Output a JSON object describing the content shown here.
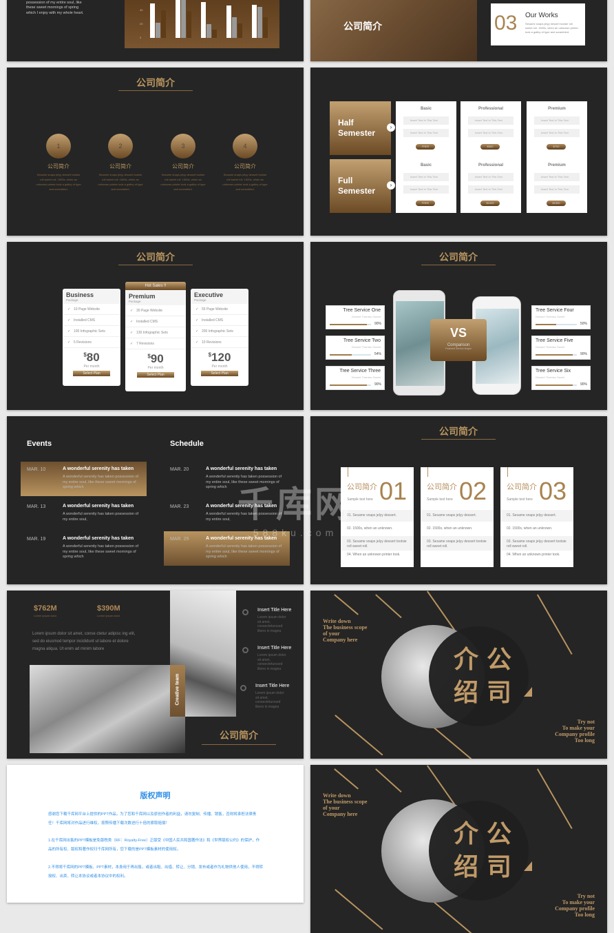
{
  "colors": {
    "slide_bg": "#252525",
    "gold": "#b58f5e",
    "copyright_blue": "#2f8fe6"
  },
  "row0": {
    "left_text": "A wonderful serenity has taken possession of my entire soul, like these sweet mornings of spring which I enjoy with my whole heart.",
    "chart_bars": [
      [
        50,
        22,
        40
      ],
      [
        55,
        60,
        39
      ],
      [
        52,
        20,
        12
      ],
      [
        47,
        30,
        21
      ],
      [
        48,
        45,
        30
      ]
    ],
    "chart_yticks": [
      "0",
      "20",
      "40"
    ],
    "right_title": "公司简介",
    "card_num": "03",
    "card_title": "Our Works",
    "card_text": "Sesame snaps jelyy dessert toolsie roll sweet roll. 1500s, when an unknown printer took a galley of type and scrambled."
  },
  "row1": {
    "title": "公司简介",
    "steps": [
      {
        "num": "1",
        "label": "公司简介",
        "text": "Sesame snaps jelyy dessert tootsie roll sweet roll. 1500s, when an unknown printer took a galley of type and scrambled."
      },
      {
        "num": "2",
        "label": "公司简介",
        "text": "Sesame snaps jelyy dessert tootsie roll sweet roll. 1500s, when an unknown printer took a galley of type and scrambled."
      },
      {
        "num": "3",
        "label": "公司简介",
        "text": "Sesame snaps jelyy dessert tootsie roll sweet roll. 1500s, when an unknown printer took a galley of type and scrambled."
      },
      {
        "num": "4",
        "label": "公司简介",
        "text": "Sesame snaps jelyy dessert tootsie roll sweet roll. 1500s, when an unknown printer took a galley of type and scrambled."
      }
    ],
    "semesters": [
      "Half Semester",
      "Full Semester"
    ],
    "plans": [
      "Basic",
      "Professional",
      "Premium"
    ],
    "feature": "Insert Text In This Text",
    "prices": [
      [
        "FREE",
        "$500",
        "$700"
      ],
      [
        "FREE",
        "$1000",
        "$1500"
      ]
    ]
  },
  "row2": {
    "title_left": "公司简介",
    "packages": [
      {
        "name": "Business",
        "sub": "Package",
        "features": [
          "10 Page Website",
          "Installed CMS",
          "100 Infographic Sets",
          "5 Revisions"
        ],
        "price": "80",
        "period": "Per month",
        "cta": "Select Plan"
      },
      {
        "name": "Premium",
        "sub": "Package",
        "badge": "Hot Sales !!",
        "features": [
          "30 Page Website",
          "Installed CMS",
          "130 Infographic Sets",
          "7 Revisions"
        ],
        "price": "90",
        "period": "Per month",
        "cta": "Select Plan"
      },
      {
        "name": "Executive",
        "sub": "Package",
        "features": [
          "55 Page Website",
          "Installed CMS",
          "200 Infographic Sets",
          "10 Revisions"
        ],
        "price": "120",
        "period": "Per month",
        "cta": "Select Plan"
      }
    ],
    "currency": "$",
    "title_right": "公司简介",
    "services": [
      {
        "name": "Tree Service One",
        "sub": "Dessert Tiramisu Sweet",
        "pct": 90,
        "label": "90%"
      },
      {
        "name": "Tree Service Two",
        "sub": "Dessert Tiramisu Sweet",
        "pct": 54,
        "label": "54%"
      },
      {
        "name": "Tree Service Three",
        "sub": "Dessert Tiramisu Sweet",
        "pct": 90,
        "label": "90%"
      },
      {
        "name": "Tree Service Four",
        "sub": "Dessert Tiramisu Sweet",
        "pct": 50,
        "label": "50%"
      },
      {
        "name": "Tree Service Five",
        "sub": "Dessert Tiramisu Sweet",
        "pct": 90,
        "label": "90%"
      },
      {
        "name": "Tree Service Six",
        "sub": "Dessert Tiramisu Sweet",
        "pct": 90,
        "label": "90%"
      }
    ],
    "vs": "VS",
    "vs_sub": "Comparison",
    "vs_slogan": "Featured Service slogan"
  },
  "row3": {
    "events_title": "Events",
    "schedule_title": "Schedule",
    "events": [
      {
        "date": "MAR. 10",
        "title": "A wonderful serenity has taken",
        "text": "A wonderful serenity has taken possession of my entire soul, like these sweet mornings of spring which",
        "hl": true
      },
      {
        "date": "MAR. 13",
        "title": "A wonderful serenity has taken",
        "text": "A wonderful serenity has taken possession of my entire soul,",
        "hl": false
      },
      {
        "date": "MAR. 19",
        "title": "A wonderful serenity has taken",
        "text": "A wonderful serenity has taken possession of my entire soul, like these sweet mornings of spring which",
        "hl": false
      }
    ],
    "schedule": [
      {
        "date": "MAR. 20",
        "title": "A wonderful serenity has taken",
        "text": "A wonderful serenity has taken possession of my entire soul, like these sweet mornings of spring which",
        "hl": false
      },
      {
        "date": "MAR. 23",
        "title": "A wonderful serenity has taken",
        "text": "A wonderful serenity has taken possession of my entire soul,",
        "hl": false
      },
      {
        "date": "MAR. 29",
        "title": "A wonderful serenity has taken",
        "text": "A wonderful serenity has taken possession of my entire soul, like these sweet mornings of spring which",
        "hl": true
      }
    ],
    "title_right": "公司简介",
    "cards": [
      {
        "cn": "公司简介",
        "num": "01",
        "sample": "Sample text here",
        "items": [
          "01. Sesame snaps jelyy dessert.",
          "02. 1500s, when an unknown.",
          "03. Sesame snaps jelyy dessert tootsie roll sweet roll.",
          "04. When an unknown printer took."
        ]
      },
      {
        "cn": "公司简介",
        "num": "02",
        "sample": "Sample text here",
        "items": [
          "01. Sesame snaps jelyy dessert.",
          "02. 1500s, when an unknown.",
          "03. Sesame snaps jelyy dessert tootsie roll sweet roll."
        ]
      },
      {
        "cn": "公司简介",
        "num": "03",
        "sample": "Sample text here",
        "items": [
          "01. Sesame snaps jelyy dessert.",
          "02. 1500s, when an unknown.",
          "03. Sesame snaps jelyy dessert tootsie roll sweet roll.",
          "04. When an unknown printer took."
        ]
      }
    ]
  },
  "row4": {
    "stat1": "$762M",
    "stat1_sub": "Lorem ipsum dolor",
    "stat2": "$390M",
    "stat2_sub": "Lorem ipsum dolor",
    "para": "Lorem ipsum dolor sit amet, conse ctetur adipisc ing elit, sed do eiusmod tempor incididunt ut labore et dolore magna aliqua. Ut enim ad minim labore",
    "strip": "Creative team",
    "items": [
      {
        "title": "Insert Title Here",
        "text": "Lorem ipsum dolor sit amet, consecteturssed libero in magna"
      },
      {
        "title": "Insert Title Here",
        "text": "Lorem ipsum dolor sit amet, consecteturssed libero in magna"
      },
      {
        "title": "Insert Title Here",
        "text": "Lorem ipsum dolor sit amet, consecteturssed libero in magna"
      }
    ],
    "title": "公司简介"
  },
  "moon": {
    "top_left": [
      "Write down",
      "The business scope",
      "of your",
      "Company here"
    ],
    "chars": [
      "介",
      "公",
      "绍",
      "司"
    ],
    "bottom_right": [
      "Try not",
      "To make your",
      "Company profile",
      "Too long"
    ]
  },
  "copyright": {
    "title": "版权声明",
    "p1": "感谢您下载千库网平台上提供的PPT作品，为了您和千库网以及原创作者的利益，请勿复制、传播、销售，否则将承担法律责任！千库网将对作品进行维权，按照传播下载次数进行十倍的索取赔偿！",
    "p2": "1.在千库网出售的PPT模板是免版税类（RF：Royalty-Free）正版受《中国人民共和国著作法》和《世界版权公约》的保护，作品的所有权、版权和著作权归千库网所有，您下载的是PPT模板素材的使用权。",
    "p3": "2.不得将千库网的PPT模板、PPT素材，本身用于再出售，或者出租、出借、转让、分销、发布或者作为礼物供他人使用，不得转授权、出卖、转让本协议或者本协议中的权利。"
  },
  "watermark": {
    "brand": "千库网",
    "url": "588ku.com"
  }
}
